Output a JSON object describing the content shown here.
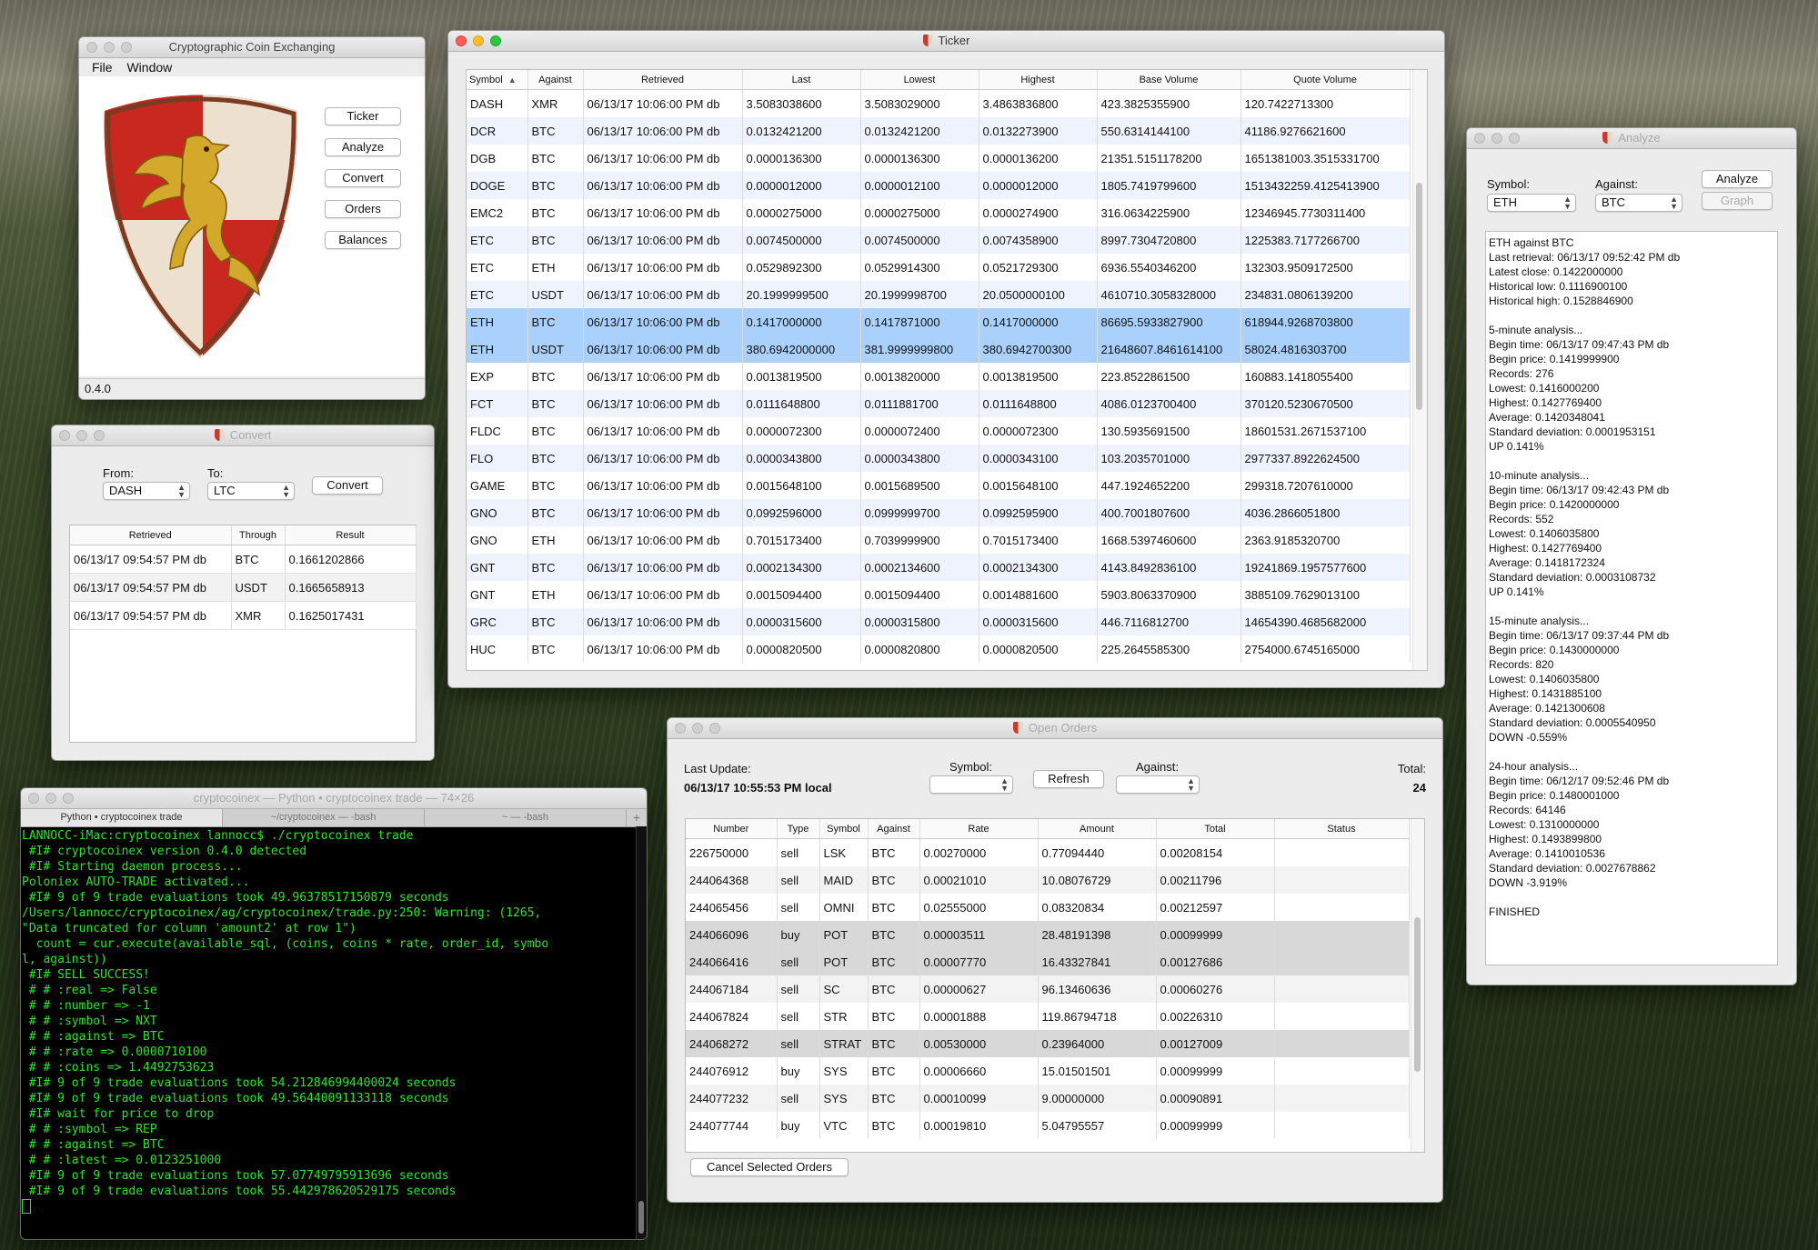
{
  "main_window": {
    "title": "Cryptographic Coin Exchanging",
    "menu": [
      "File",
      "Window"
    ],
    "buttons": [
      "Ticker",
      "Analyze",
      "Convert",
      "Orders",
      "Balances"
    ],
    "version": "0.4.0"
  },
  "convert": {
    "title": "Convert",
    "from_label": "From:",
    "from_value": "DASH",
    "to_label": "To:",
    "to_value": "LTC",
    "convert_button": "Convert",
    "columns": [
      "Retrieved",
      "Through",
      "Result"
    ],
    "rows": [
      [
        "06/13/17 09:54:57 PM db",
        "BTC",
        "0.1661202866"
      ],
      [
        "06/13/17 09:54:57 PM db",
        "USDT",
        "0.1665658913"
      ],
      [
        "06/13/17 09:54:57 PM db",
        "XMR",
        "0.1625017431"
      ]
    ]
  },
  "ticker": {
    "title": "Ticker",
    "columns": [
      "Symbol",
      "Against",
      "Retrieved",
      "Last",
      "Lowest",
      "Highest",
      "Base Volume",
      "Quote Volume"
    ],
    "sort_indicator": "▲",
    "rows": [
      [
        "DASH",
        "XMR",
        "06/13/17 10:06:00 PM db",
        "3.5083038600",
        "3.5083029000",
        "3.4863836800",
        "423.3825355900",
        "120.7422713300"
      ],
      [
        "DCR",
        "BTC",
        "06/13/17 10:06:00 PM db",
        "0.0132421200",
        "0.0132421200",
        "0.0132273900",
        "550.6314144100",
        "41186.9276621600"
      ],
      [
        "DGB",
        "BTC",
        "06/13/17 10:06:00 PM db",
        "0.0000136300",
        "0.0000136300",
        "0.0000136200",
        "21351.5151178200",
        "1651381003.3515331700"
      ],
      [
        "DOGE",
        "BTC",
        "06/13/17 10:06:00 PM db",
        "0.0000012000",
        "0.0000012100",
        "0.0000012000",
        "1805.7419799600",
        "1513432259.4125413900"
      ],
      [
        "EMC2",
        "BTC",
        "06/13/17 10:06:00 PM db",
        "0.0000275000",
        "0.0000275000",
        "0.0000274900",
        "316.0634225900",
        "12346945.7730311400"
      ],
      [
        "ETC",
        "BTC",
        "06/13/17 10:06:00 PM db",
        "0.0074500000",
        "0.0074500000",
        "0.0074358900",
        "8997.7304720800",
        "1225383.7177266700"
      ],
      [
        "ETC",
        "ETH",
        "06/13/17 10:06:00 PM db",
        "0.0529892300",
        "0.0529914300",
        "0.0521729300",
        "6936.5540346200",
        "132303.9509172500"
      ],
      [
        "ETC",
        "USDT",
        "06/13/17 10:06:00 PM db",
        "20.1999999500",
        "20.1999998700",
        "20.0500000100",
        "4610710.3058328000",
        "234831.0806139200"
      ],
      [
        "ETH",
        "BTC",
        "06/13/17 10:06:00 PM db",
        "0.1417000000",
        "0.1417871000",
        "0.1417000000",
        "86695.5933827900",
        "618944.9268703800"
      ],
      [
        "ETH",
        "USDT",
        "06/13/17 10:06:00 PM db",
        "380.6942000000",
        "381.9999999800",
        "380.6942700300",
        "21648607.8461614100",
        "58024.4816303700"
      ],
      [
        "EXP",
        "BTC",
        "06/13/17 10:06:00 PM db",
        "0.0013819500",
        "0.0013820000",
        "0.0013819500",
        "223.8522861500",
        "160883.1418055400"
      ],
      [
        "FCT",
        "BTC",
        "06/13/17 10:06:00 PM db",
        "0.0111648800",
        "0.0111881700",
        "0.0111648800",
        "4086.0123700400",
        "370120.5230670500"
      ],
      [
        "FLDC",
        "BTC",
        "06/13/17 10:06:00 PM db",
        "0.0000072300",
        "0.0000072400",
        "0.0000072300",
        "130.5935691500",
        "18601531.2671537100"
      ],
      [
        "FLO",
        "BTC",
        "06/13/17 10:06:00 PM db",
        "0.0000343800",
        "0.0000343800",
        "0.0000343100",
        "103.2035701000",
        "2977337.8922624500"
      ],
      [
        "GAME",
        "BTC",
        "06/13/17 10:06:00 PM db",
        "0.0015648100",
        "0.0015689500",
        "0.0015648100",
        "447.1924652200",
        "299318.7207610000"
      ],
      [
        "GNO",
        "BTC",
        "06/13/17 10:06:00 PM db",
        "0.0992596000",
        "0.0999999700",
        "0.0992595900",
        "400.7001807600",
        "4036.2866051800"
      ],
      [
        "GNO",
        "ETH",
        "06/13/17 10:06:00 PM db",
        "0.7015173400",
        "0.7039999900",
        "0.7015173400",
        "1668.5397460600",
        "2363.9185320700"
      ],
      [
        "GNT",
        "BTC",
        "06/13/17 10:06:00 PM db",
        "0.0002134300",
        "0.0002134600",
        "0.0002134300",
        "4143.8492836100",
        "19241869.1957577600"
      ],
      [
        "GNT",
        "ETH",
        "06/13/17 10:06:00 PM db",
        "0.0015094400",
        "0.0015094400",
        "0.0014881600",
        "5903.8063370900",
        "3885109.7629013100"
      ],
      [
        "GRC",
        "BTC",
        "06/13/17 10:06:00 PM db",
        "0.0000315600",
        "0.0000315800",
        "0.0000315600",
        "446.7116812700",
        "14654390.4685682000"
      ],
      [
        "HUC",
        "BTC",
        "06/13/17 10:06:00 PM db",
        "0.0000820500",
        "0.0000820800",
        "0.0000820500",
        "225.2645585300",
        "2754000.6745165000"
      ]
    ],
    "selected_rows": [
      8,
      9
    ]
  },
  "analyze": {
    "title": "Analyze",
    "symbol_label": "Symbol:",
    "symbol_value": "ETH",
    "against_label": "Against:",
    "against_value": "BTC",
    "analyze_button": "Analyze",
    "graph_button": "Graph",
    "output": "ETH against BTC\nLast retrieval: 06/13/17 09:52:42 PM db\nLatest close: 0.1422000000\nHistorical low: 0.1116900100\nHistorical high: 0.1528846900\n\n5-minute analysis...\nBegin time: 06/13/17 09:47:43 PM db\nBegin price: 0.1419999900\nRecords: 276\nLowest: 0.1416000200\nHighest: 0.1427769400\nAverage: 0.1420348041\nStandard deviation: 0.0001953151\nUP 0.141%\n\n10-minute analysis...\nBegin time: 06/13/17 09:42:43 PM db\nBegin price: 0.1420000000\nRecords: 552\nLowest: 0.1406035800\nHighest: 0.1427769400\nAverage: 0.1418172324\nStandard deviation: 0.0003108732\nUP 0.141%\n\n15-minute analysis...\nBegin time: 06/13/17 09:37:44 PM db\nBegin price: 0.1430000000\nRecords: 820\nLowest: 0.1406035800\nHighest: 0.1431885100\nAverage: 0.1421300608\nStandard deviation: 0.0005540950\nDOWN -0.559%\n\n24-hour analysis...\nBegin time: 06/12/17 09:52:46 PM db\nBegin price: 0.1480001000\nRecords: 64146\nLowest: 0.1310000000\nHighest: 0.1493899800\nAverage: 0.1410010536\nStandard deviation: 0.0027678862\nDOWN -3.919%\n\nFINISHED"
  },
  "orders": {
    "title": "Open Orders",
    "last_update_label": "Last Update:",
    "last_update_value": "06/13/17 10:55:53 PM local",
    "symbol_label": "Symbol:",
    "refresh_button": "Refresh",
    "against_label": "Against:",
    "total_label": "Total:",
    "total_value": "24",
    "cancel_button": "Cancel Selected Orders",
    "columns": [
      "Number",
      "Type",
      "Symbol",
      "Against",
      "Rate",
      "Amount",
      "Total",
      "Status"
    ],
    "rows": [
      [
        "226750000",
        "sell",
        "LSK",
        "BTC",
        "0.00270000",
        "0.77094440",
        "0.00208154",
        ""
      ],
      [
        "244064368",
        "sell",
        "MAID",
        "BTC",
        "0.00021010",
        "10.08076729",
        "0.00211796",
        ""
      ],
      [
        "244065456",
        "sell",
        "OMNI",
        "BTC",
        "0.02555000",
        "0.08320834",
        "0.00212597",
        ""
      ],
      [
        "244066096",
        "buy",
        "POT",
        "BTC",
        "0.00003511",
        "28.48191398",
        "0.00099999",
        ""
      ],
      [
        "244066416",
        "sell",
        "POT",
        "BTC",
        "0.00007770",
        "16.43327841",
        "0.00127686",
        ""
      ],
      [
        "244067184",
        "sell",
        "SC",
        "BTC",
        "0.00000627",
        "96.13460636",
        "0.00060276",
        ""
      ],
      [
        "244067824",
        "sell",
        "STR",
        "BTC",
        "0.00001888",
        "119.86794718",
        "0.00226310",
        ""
      ],
      [
        "244068272",
        "sell",
        "STRAT",
        "BTC",
        "0.00530000",
        "0.23964000",
        "0.00127009",
        ""
      ],
      [
        "244076912",
        "buy",
        "SYS",
        "BTC",
        "0.00006660",
        "15.01501501",
        "0.00099999",
        ""
      ],
      [
        "244077232",
        "sell",
        "SYS",
        "BTC",
        "0.00010099",
        "9.00000000",
        "0.00090891",
        ""
      ],
      [
        "244077744",
        "buy",
        "VTC",
        "BTC",
        "0.00019810",
        "5.04795557",
        "0.00099999",
        ""
      ]
    ],
    "selected_rows": [
      3,
      4,
      7
    ]
  },
  "terminal": {
    "title": "cryptocoinex — Python • cryptocoinex trade — 74×26",
    "tabs": [
      "Python • cryptocoinex trade",
      "~/cryptocoinex — -bash",
      "~ — -bash"
    ],
    "lines": [
      "LANNOCC-iMac:cryptocoinex lannocc$ ./cryptocoinex trade",
      " #I# cryptocoinex version 0.4.0 detected",
      " #I# Starting daemon process...",
      "Poloniex AUTO-TRADE activated...",
      " #I# 9 of 9 trade evaluations took 49.96378517150879 seconds",
      "/Users/lannocc/cryptocoinex/ag/cryptocoinex/trade.py:250: Warning: (1265,",
      "\"Data truncated for column 'amount2' at row 1\")",
      "  count = cur.execute(available_sql, (coins, coins * rate, order_id, symbo",
      "l, against))",
      " #I# SELL SUCCESS!",
      " # # :real => False",
      " # # :number => -1",
      " # # :symbol => NXT",
      " # # :against => BTC",
      " # # :rate => 0.0000710100",
      " # # :coins => 1.4492753623",
      " #I# 9 of 9 trade evaluations took 54.212846994400024 seconds",
      " #I# 9 of 9 trade evaluations took 49.56440091133118 seconds",
      " #I# wait for price to drop",
      " # # :symbol => REP",
      " # # :against => BTC",
      " # # :latest => 0.0123251000",
      " #I# 9 of 9 trade evaluations took 57.07749795913696 seconds",
      " #I# 9 of 9 trade evaluations took 55.442978620529175 seconds"
    ]
  },
  "colors": {
    "selection_blue": "#a9d1fb",
    "row_stripe_blue": "#eef3fd",
    "terminal_green": "#2ce42c",
    "shield_red": "#c8281e",
    "shield_cream": "#eee0cf",
    "griffin_gold": "#d4a82a"
  },
  "icons": {
    "shield": "griffin-shield-logo",
    "sort": "sort-ascending-icon",
    "popup": "popup-arrows-icon"
  }
}
